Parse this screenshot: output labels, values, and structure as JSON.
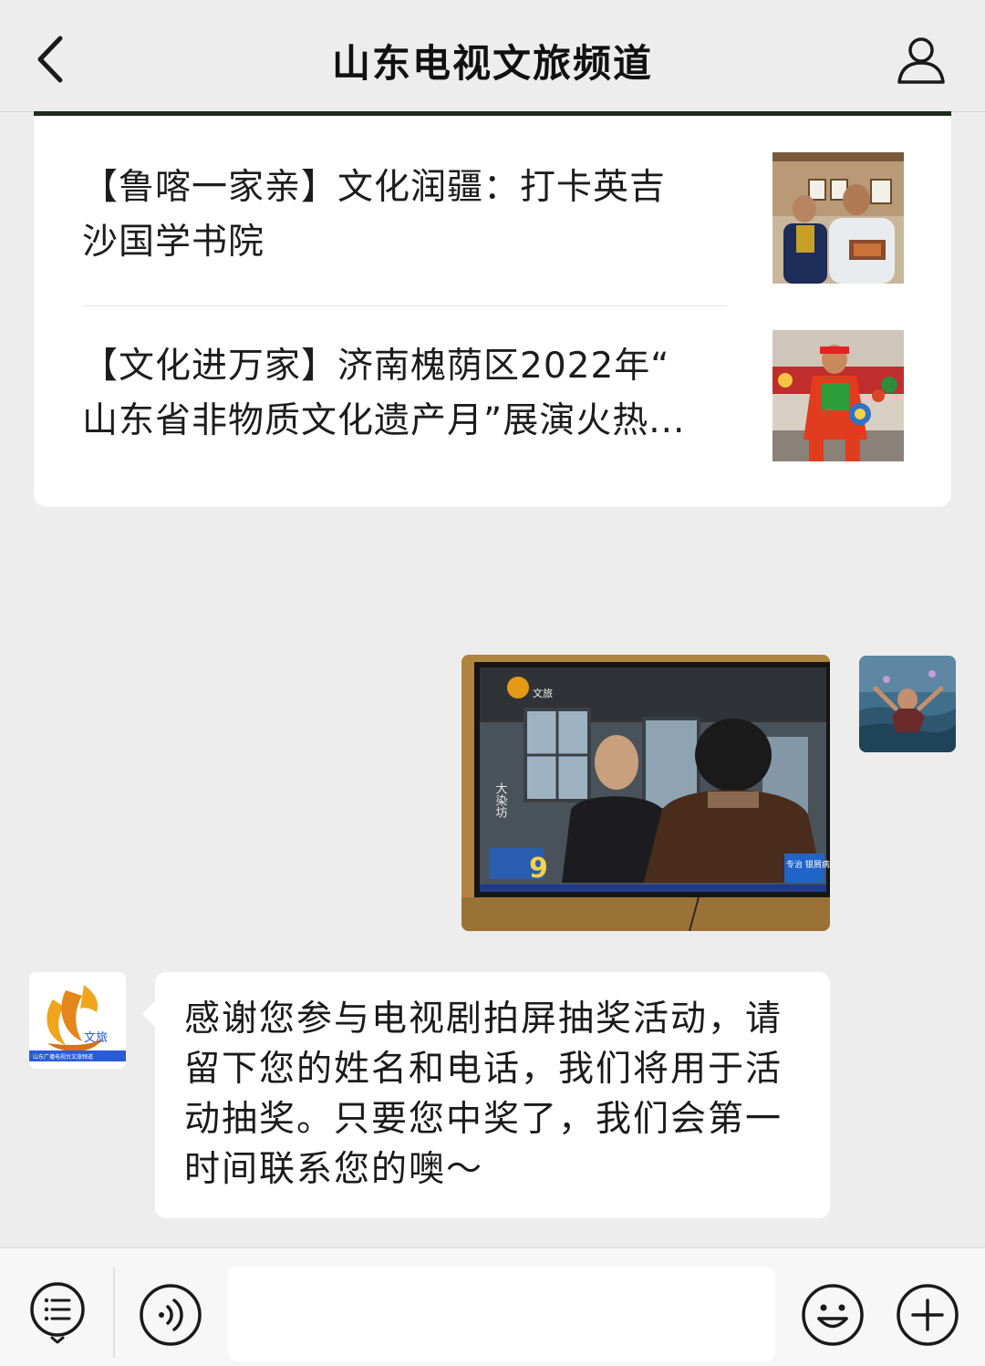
{
  "header": {
    "title": "山东电视文旅频道"
  },
  "articles": [
    {
      "title_line1": "【鲁喀一家亲】文化润疆：打卡英吉",
      "title_line2": "沙国学书院"
    },
    {
      "title_line1": "【文化进万家】济南槐荫区2022年“",
      "title_line2": "山东省非物质文化遗产月”展演火热..."
    }
  ],
  "sent_image": {
    "channel_logo_text": "文旅",
    "show_title": "大染坊",
    "number_badge": "9",
    "corner_caption": "专治 银屑病"
  },
  "channel_avatar": {
    "logo_text": "文旅",
    "caption": "山东广播电视台文旅频道"
  },
  "reply": {
    "text": "感谢您参与电视剧拍屏抽奖活动，请留下您的姓名和电话，我们将用于活动抽奖。只要您中奖了，我们会第一时间联系您的噢～"
  },
  "input_bar": {
    "placeholder": "",
    "icons": [
      "menu-icon",
      "voice-icon",
      "emoji-icon",
      "plus-icon"
    ]
  },
  "colors": {
    "background": "#ededed",
    "bubble": "#ffffff",
    "brand_orange": "#e58a12",
    "brand_blue": "#2a5bd7"
  }
}
